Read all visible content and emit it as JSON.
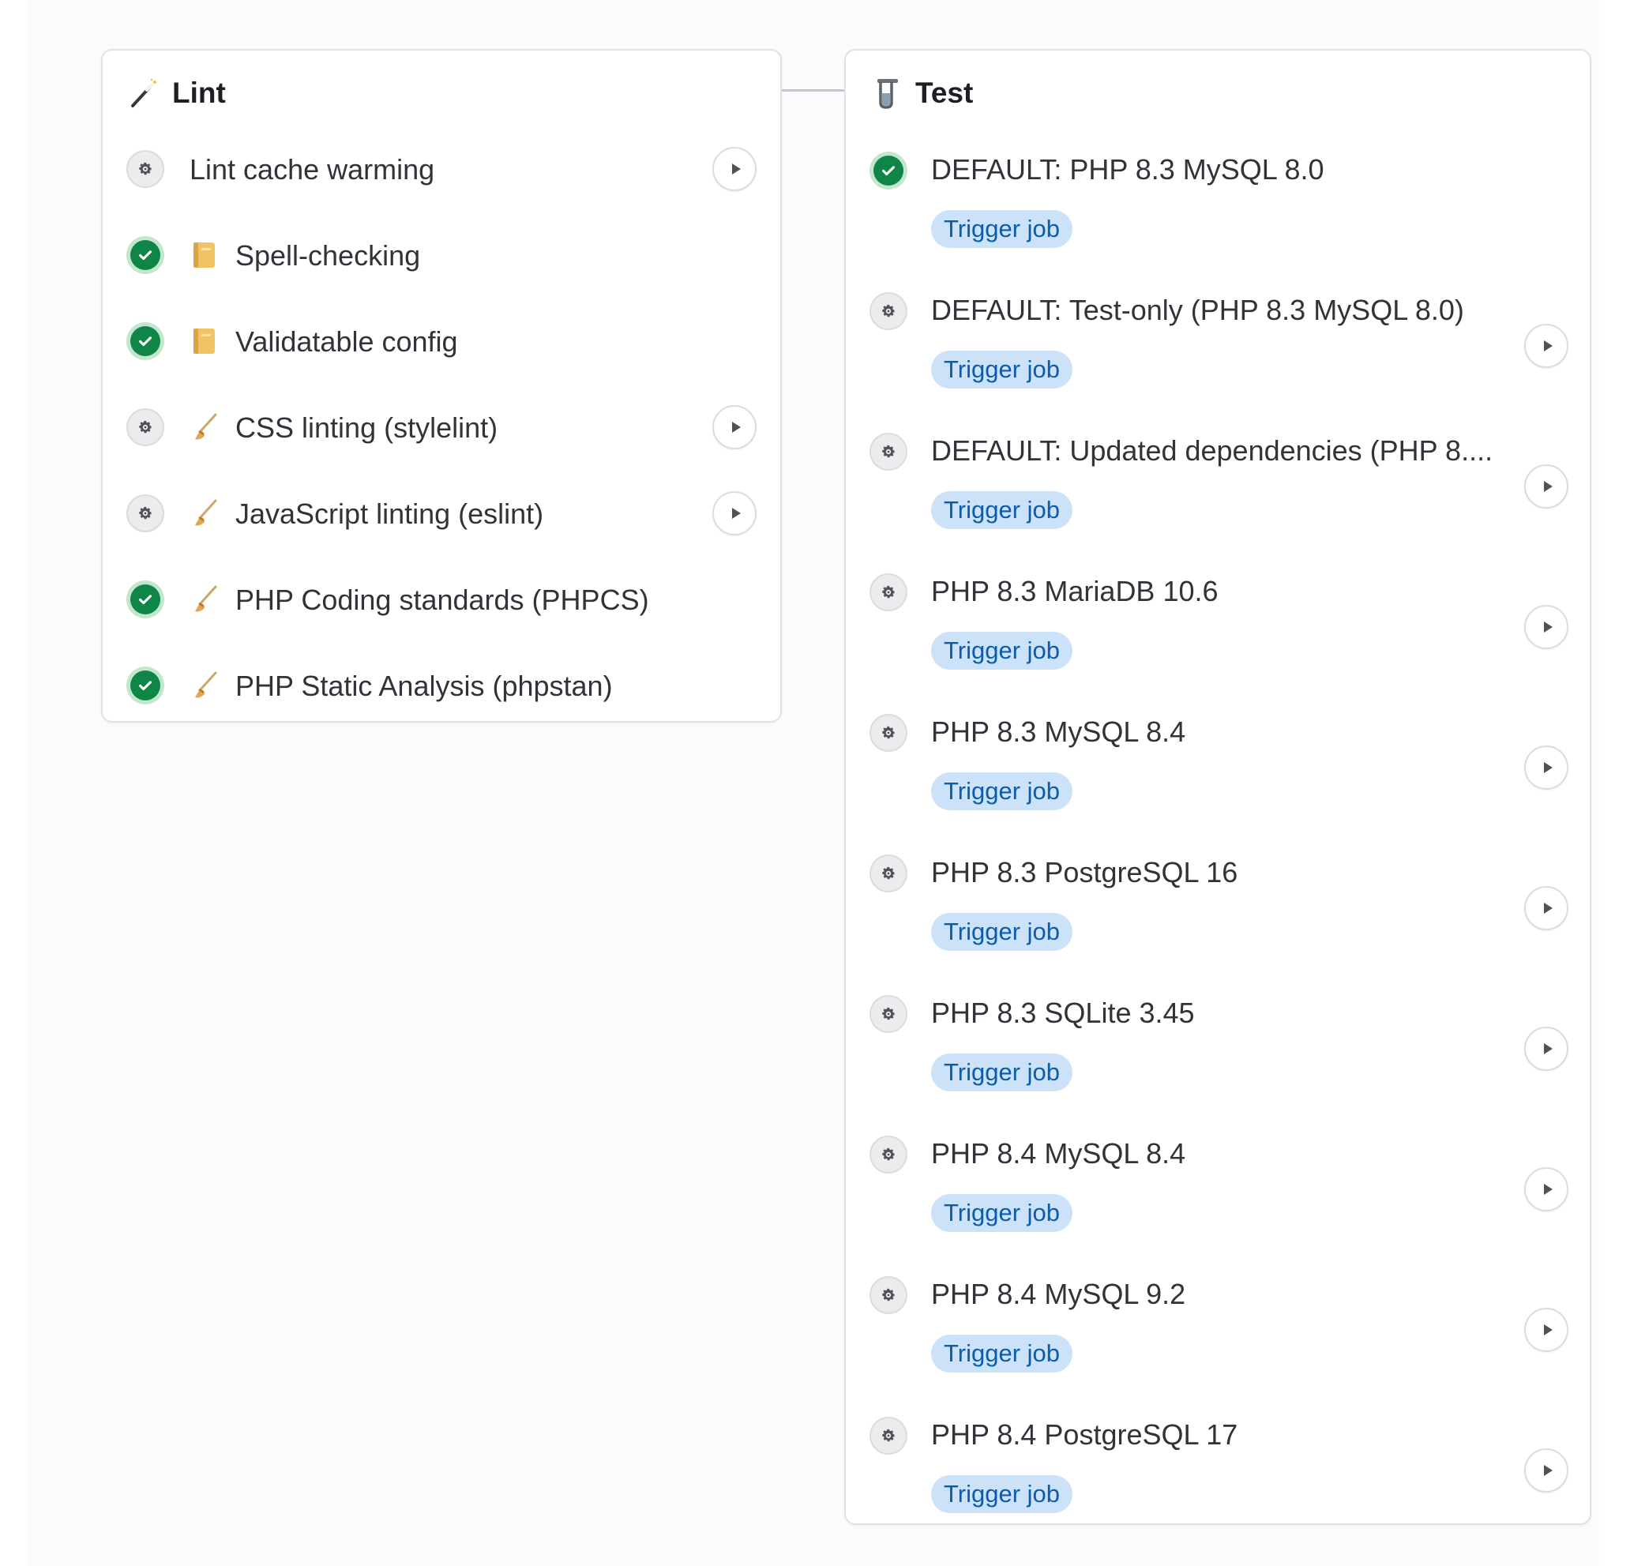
{
  "colors": {
    "success": "#108548",
    "success_ring": "#c3e6cd",
    "badge_bg": "#cbe2f9",
    "badge_text": "#0b5cad",
    "border": "#e2e1e6"
  },
  "lint": {
    "title": "Lint",
    "icon": "magic-wand-icon",
    "jobs": [
      {
        "label": "Lint cache warming",
        "status": "manual",
        "emoji": "",
        "action": "play"
      },
      {
        "label": "Spell-checking",
        "status": "success",
        "emoji": "notebook-icon",
        "action": ""
      },
      {
        "label": "Validatable config",
        "status": "success",
        "emoji": "notebook-icon",
        "action": ""
      },
      {
        "label": "CSS linting (stylelint)",
        "status": "manual",
        "emoji": "broom-icon",
        "action": "play"
      },
      {
        "label": "JavaScript linting (eslint)",
        "status": "manual",
        "emoji": "broom-icon",
        "action": "play"
      },
      {
        "label": "PHP Coding standards (PHPCS)",
        "status": "success",
        "emoji": "broom-icon",
        "action": ""
      },
      {
        "label": "PHP Static Analysis (phpstan)",
        "status": "success",
        "emoji": "broom-icon",
        "action": ""
      }
    ]
  },
  "test": {
    "title": "Test",
    "icon": "test-tube-icon",
    "jobs": [
      {
        "label": "DEFAULT: PHP 8.3 MySQL 8.0",
        "status": "success",
        "badge": "Trigger job",
        "action": ""
      },
      {
        "label": "DEFAULT: Test-only (PHP 8.3 MySQL 8.0)",
        "status": "manual",
        "badge": "Trigger job",
        "action": "play"
      },
      {
        "label": "DEFAULT: Updated dependencies (PHP 8....",
        "status": "manual",
        "badge": "Trigger job",
        "action": "play"
      },
      {
        "label": "PHP 8.3 MariaDB 10.6",
        "status": "manual",
        "badge": "Trigger job",
        "action": "play"
      },
      {
        "label": "PHP 8.3 MySQL 8.4",
        "status": "manual",
        "badge": "Trigger job",
        "action": "play"
      },
      {
        "label": "PHP 8.3 PostgreSQL 16",
        "status": "manual",
        "badge": "Trigger job",
        "action": "play"
      },
      {
        "label": "PHP 8.3 SQLite 3.45",
        "status": "manual",
        "badge": "Trigger job",
        "action": "play"
      },
      {
        "label": "PHP 8.4 MySQL 8.4",
        "status": "manual",
        "badge": "Trigger job",
        "action": "play"
      },
      {
        "label": "PHP 8.4 MySQL 9.2",
        "status": "manual",
        "badge": "Trigger job",
        "action": "play"
      },
      {
        "label": "PHP 8.4 PostgreSQL 17",
        "status": "manual",
        "badge": "Trigger job",
        "action": "play"
      }
    ]
  }
}
